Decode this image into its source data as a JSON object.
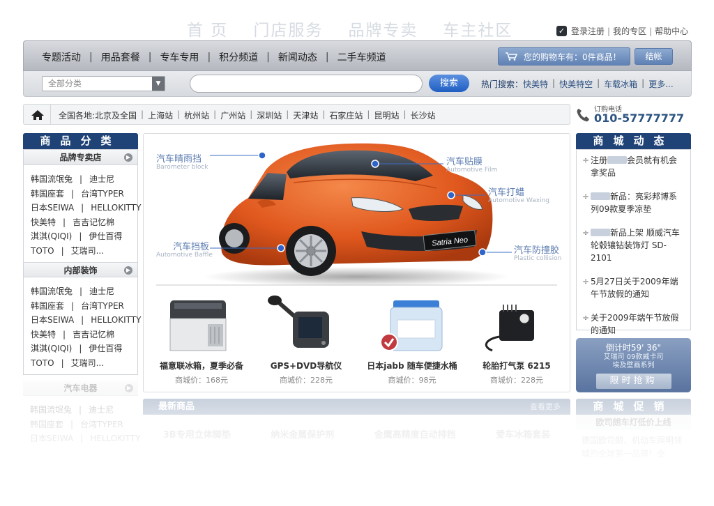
{
  "top_nav": [
    "首 页",
    "门店服务",
    "品牌专卖",
    "车主社区"
  ],
  "top_links": [
    "登录注册",
    "我的专区",
    "帮助中心"
  ],
  "main_nav": [
    "专题活动",
    "用品套餐",
    "专车专用",
    "积分频道",
    "新闻动态",
    "二手车频道"
  ],
  "cart": {
    "label": "您的购物车有：0件商品！",
    "checkout": "结帐"
  },
  "search": {
    "category": "全部分类",
    "button": "搜索",
    "hot_label": "热门搜索：",
    "hot": [
      "快美特",
      "快美特空",
      "车载冰箱",
      "更多..."
    ]
  },
  "citybar": {
    "cities": [
      "全国各地:北京及全国",
      "上海站",
      "杭州站",
      "广州站",
      "深圳站",
      "天津站",
      "石家庄站",
      "昆明站",
      "长沙站"
    ]
  },
  "hotline": {
    "label": "订购电话",
    "number": "010-57777777"
  },
  "left": {
    "title": "商品分类",
    "sections": [
      {
        "title": "品牌专卖店",
        "rows": [
          [
            "韩国流氓兔",
            "迪士尼"
          ],
          [
            "韩国座套",
            "台湾TYPER"
          ],
          [
            "日本SEIWA",
            "HELLOKITTY"
          ],
          [
            "快美特",
            "吉吉记忆棉"
          ],
          [
            "淇淇(QIQI)",
            "伊仕百得"
          ],
          [
            "TOTO",
            "艾瑞司..."
          ]
        ]
      },
      {
        "title": "内部装饰",
        "rows": [
          [
            "韩国流氓兔",
            "迪士尼"
          ],
          [
            "韩国座套",
            "台湾TYPER"
          ],
          [
            "日本SEIWA",
            "HELLOKITTY"
          ],
          [
            "快美特",
            "吉吉记忆棉"
          ],
          [
            "淇淇(QIQI)",
            "伊仕百得"
          ],
          [
            "TOTO",
            "艾瑞司..."
          ]
        ]
      },
      {
        "title": "汽车电器",
        "rows": [
          [
            "韩国流氓兔",
            "迪士尼"
          ],
          [
            "韩国座套",
            "台湾TYPER"
          ],
          [
            "日本SEIWA",
            "HELLOKITTY"
          ]
        ]
      }
    ]
  },
  "callouts": [
    {
      "cn": "汽车晴雨挡",
      "en": "Barometer block"
    },
    {
      "cn": "汽车贴膜",
      "en": "Automotive Film"
    },
    {
      "cn": "汽车打蜡",
      "en": "Automotive Waxing"
    },
    {
      "cn": "汽车挡板",
      "en": "Automotive Baffle"
    },
    {
      "cn": "汽车防撞胶",
      "en": "Plastic collision"
    }
  ],
  "car_plate": "Satria Neo",
  "products": [
    {
      "name": "福意联冰箱，夏季必备",
      "price": "商城价：168元"
    },
    {
      "name": "GPS+DVD导航仪",
      "price": "商城价：228元"
    },
    {
      "name": "日本jabb 随车便捷水桶",
      "price": "商城价：98元"
    },
    {
      "name": "轮胎打气泵 6215",
      "price": "商城价：228元"
    }
  ],
  "right": {
    "title": "商城动态",
    "news": [
      {
        "pre": "注册",
        "post": "会员就有机会拿奖品"
      },
      {
        "pre": "",
        "post": "新品：亮彩邦博系列09款夏季凉垫"
      },
      {
        "pre": "",
        "post": "新品上架 顺威汽车轮毂镶钻装饰灯 SD-2101"
      },
      {
        "pre": "5月27日关于2009年端午节放假的通知",
        "post": ""
      },
      {
        "pre": "关于2009年端午节放假的通知",
        "post": ""
      }
    ]
  },
  "countdown": {
    "time": "倒计时59' 36\"",
    "line1": "艾瑞司 09款威卡司",
    "line2": "埃及壁画系列",
    "button": "限时抢购"
  },
  "latest": {
    "title": "最新商品",
    "more": "查看更多",
    "items": [
      "3B专用立体脚垫",
      "纳米金属保护剂",
      "金鹰高精度自动排挡",
      "爱车冰箱套装"
    ]
  },
  "promo": {
    "title": "商城促销",
    "sub": "欧司朗车灯低价上线",
    "text": "德国欧司朗，机动车照明领域的全球第一品牌！全"
  },
  "colors": {
    "navy": "#1f4377",
    "accent_blue": "#5a7bb0",
    "search_blue": "#1f5ec2",
    "car_orange": "#e0581e"
  }
}
